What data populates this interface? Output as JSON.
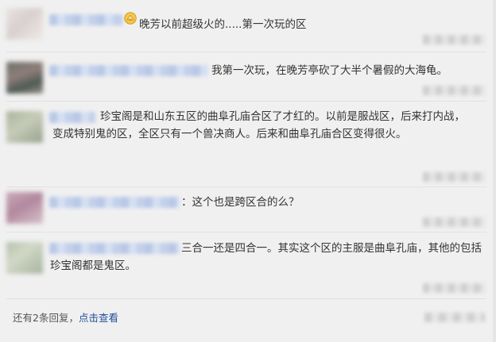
{
  "replies": [
    {
      "text": "晚芳以前超级火的.....第一次玩的区"
    },
    {
      "text": "我第一次玩，在晚芳亭砍了大半个暑假的大海龟。"
    },
    {
      "text": "珍宝阁是和山东五区的曲阜孔庙合区了才红的。以前是服战区，后来打内战，变成特别鬼的区，全区只有一个兽决商人。后来和曲阜孔庙合区变得很火。"
    },
    {
      "text": "：这个也是跨区合的么？"
    },
    {
      "text": "三合一还是四合一。其实这个区的主服是曲阜孔庙，其他的包括珍宝阁都是鬼区。"
    }
  ],
  "footer": {
    "prefix": "还有2条回复，",
    "link": "点击查看"
  },
  "colors": {
    "link": "#1e4e9a",
    "text": "#333333",
    "background": "#f0f0f0"
  },
  "icons": {
    "badge": "vip-badge-icon"
  }
}
